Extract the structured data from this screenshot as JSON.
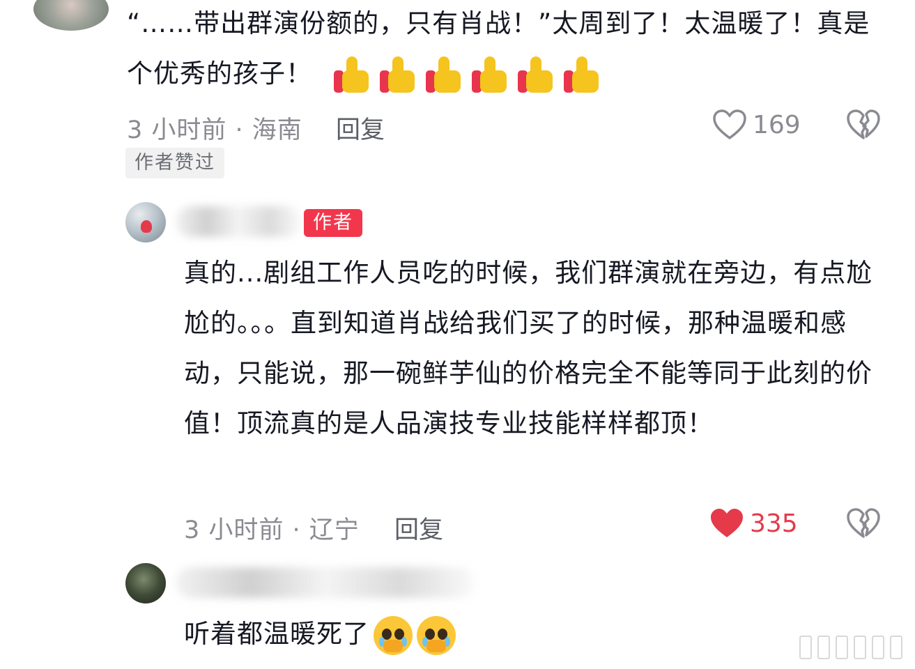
{
  "comment_top": {
    "text": "“……带出群演份额的，只有肖战！”太周到了！太温暖了！真是个优秀的孩子！",
    "emoji_icons": [
      "thumbs-up-icon",
      "thumbs-up-icon",
      "thumbs-up-icon",
      "thumbs-up-icon",
      "thumbs-up-icon",
      "thumbs-up-icon"
    ],
    "time_location": "3 小时前 · 海南",
    "reply_label": "回复",
    "like_count": "169",
    "like_state": "unliked",
    "author_liked_tag": "作者赞过"
  },
  "reply_author": {
    "badge": "作者",
    "text": "真的...剧组工作人员吃的时候，我们群演就在旁边，有点尬尬的。。。直到知道肖战给我们买了的时候，那种温暖和感动，只能说，那一碗鲜芋仙的价格完全不能等同于此刻的价值！顶流真的是人品演技专业技能样样都顶！",
    "time_location": "3 小时前 · 辽宁",
    "reply_label": "回复",
    "like_count": "335",
    "like_state": "liked"
  },
  "reply_second": {
    "text": "听着都温暖死了",
    "emoji_icons": [
      "crying-face-icon",
      "crying-face-icon"
    ]
  },
  "colors": {
    "accent_red": "#e43a4a",
    "badge_red": "#f2374d",
    "meta_gray": "#8a8b91",
    "text_dark": "#161823"
  }
}
